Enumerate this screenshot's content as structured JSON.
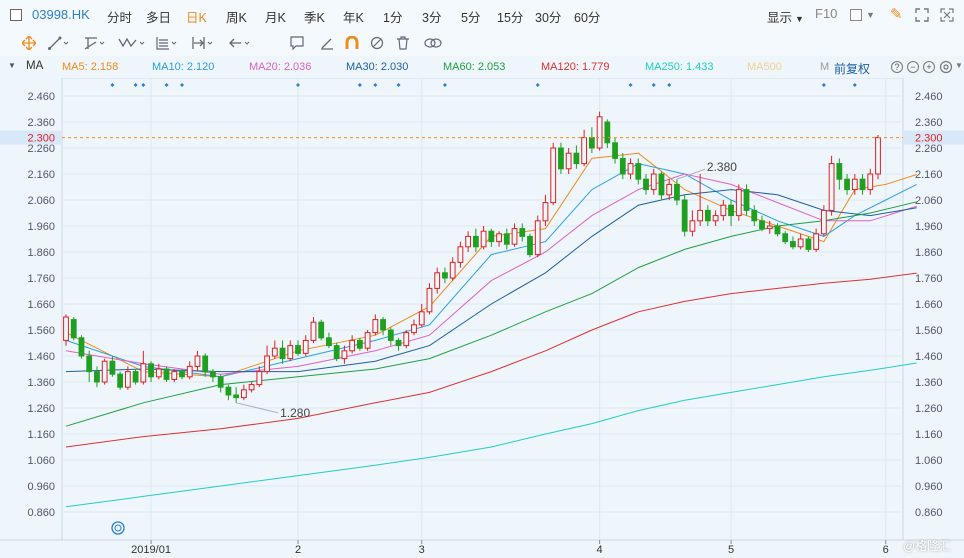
{
  "toolbar": {
    "ticker": "03998.HK",
    "periods": [
      "分时",
      "多日",
      "日K",
      "周K",
      "月K",
      "季K",
      "年K",
      "1分",
      "3分",
      "5分",
      "15分",
      "30分",
      "60分"
    ],
    "active_period": "日K",
    "display_label": "显示",
    "f10_label": "F10"
  },
  "drawing_tools": [
    "crosshair-icon",
    "line-icon",
    "channel-icon",
    "wave-icon",
    "fib-icon",
    "range-icon",
    "arrow-icon",
    "text-icon",
    "comment-icon",
    "pencil-icon",
    "magnet-icon",
    "hide-icon",
    "trash-icon",
    "link-icon"
  ],
  "drawing_text_label": "Aa",
  "indicator_bar": {
    "name": "MA",
    "items": [
      {
        "label": "MA5: 2.158",
        "color": "#f08c1a"
      },
      {
        "label": "MA10: 2.120",
        "color": "#2aa0e0"
      },
      {
        "label": "MA20: 2.036",
        "color": "#e060c0"
      },
      {
        "label": "MA30: 2.030",
        "color": "#2060a0"
      },
      {
        "label": "MA60: 2.053",
        "color": "#20a040"
      },
      {
        "label": "MA120: 1.779",
        "color": "#e03030"
      },
      {
        "label": "MA250: 1.433",
        "color": "#20d0c0"
      },
      {
        "label": "MA500",
        "color": "#f0d090"
      },
      {
        "label": "M",
        "color": "#999999"
      }
    ],
    "adjust_label": "前复权"
  },
  "chart_data": {
    "type": "candlestick",
    "y_ticks": [
      "2.460",
      "2.360",
      "2.260",
      "2.160",
      "2.060",
      "1.960",
      "1.860",
      "1.760",
      "1.660",
      "1.560",
      "1.460",
      "1.360",
      "1.260",
      "1.160",
      "1.060",
      "0.960",
      "0.860"
    ],
    "ylim": [
      0.82,
      2.5
    ],
    "x_labels": [
      "2019/01",
      "2",
      "3",
      "4",
      "5",
      "6"
    ],
    "x_label_index": [
      11,
      30,
      46,
      69,
      86,
      106
    ],
    "current_price": "2.300",
    "high_annotation": "2.380",
    "low_annotation": "1.280",
    "high_index": 79,
    "low_index": 22,
    "up_color": "#e02020",
    "down_color": "#20a020",
    "candles": [
      [
        1.52,
        1.61,
        1.62,
        1.5
      ],
      [
        1.6,
        1.53,
        1.61,
        1.52
      ],
      [
        1.53,
        1.46,
        1.54,
        1.45
      ],
      [
        1.46,
        1.4,
        1.48,
        1.36
      ],
      [
        1.4,
        1.36,
        1.42,
        1.34
      ],
      [
        1.36,
        1.44,
        1.45,
        1.35
      ],
      [
        1.44,
        1.39,
        1.46,
        1.38
      ],
      [
        1.39,
        1.34,
        1.4,
        1.33
      ],
      [
        1.34,
        1.4,
        1.42,
        1.33
      ],
      [
        1.4,
        1.36,
        1.41,
        1.35
      ],
      [
        1.36,
        1.43,
        1.48,
        1.35
      ],
      [
        1.43,
        1.38,
        1.44,
        1.36
      ],
      [
        1.38,
        1.41,
        1.43,
        1.37
      ],
      [
        1.41,
        1.37,
        1.42,
        1.36
      ],
      [
        1.37,
        1.4,
        1.41,
        1.36
      ],
      [
        1.4,
        1.38,
        1.41,
        1.37
      ],
      [
        1.38,
        1.42,
        1.44,
        1.37
      ],
      [
        1.42,
        1.46,
        1.48,
        1.4
      ],
      [
        1.46,
        1.4,
        1.47,
        1.38
      ],
      [
        1.4,
        1.38,
        1.41,
        1.36
      ],
      [
        1.38,
        1.34,
        1.39,
        1.32
      ],
      [
        1.34,
        1.31,
        1.35,
        1.29
      ],
      [
        1.31,
        1.3,
        1.34,
        1.28
      ],
      [
        1.3,
        1.33,
        1.35,
        1.29
      ],
      [
        1.33,
        1.35,
        1.36,
        1.32
      ],
      [
        1.35,
        1.4,
        1.42,
        1.34
      ],
      [
        1.4,
        1.46,
        1.5,
        1.39
      ],
      [
        1.46,
        1.49,
        1.52,
        1.45
      ],
      [
        1.49,
        1.45,
        1.52,
        1.43
      ],
      [
        1.45,
        1.5,
        1.52,
        1.44
      ],
      [
        1.5,
        1.47,
        1.52,
        1.46
      ],
      [
        1.47,
        1.52,
        1.54,
        1.46
      ],
      [
        1.52,
        1.59,
        1.61,
        1.51
      ],
      [
        1.59,
        1.53,
        1.6,
        1.52
      ],
      [
        1.53,
        1.5,
        1.55,
        1.49
      ],
      [
        1.5,
        1.45,
        1.51,
        1.44
      ],
      [
        1.45,
        1.48,
        1.5,
        1.43
      ],
      [
        1.48,
        1.52,
        1.54,
        1.47
      ],
      [
        1.52,
        1.49,
        1.53,
        1.48
      ],
      [
        1.49,
        1.55,
        1.56,
        1.48
      ],
      [
        1.55,
        1.6,
        1.62,
        1.54
      ],
      [
        1.6,
        1.56,
        1.61,
        1.54
      ],
      [
        1.56,
        1.52,
        1.57,
        1.5
      ],
      [
        1.52,
        1.5,
        1.53,
        1.48
      ],
      [
        1.5,
        1.55,
        1.56,
        1.49
      ],
      [
        1.55,
        1.58,
        1.6,
        1.54
      ],
      [
        1.58,
        1.63,
        1.66,
        1.57
      ],
      [
        1.63,
        1.72,
        1.74,
        1.62
      ],
      [
        1.72,
        1.78,
        1.8,
        1.7
      ],
      [
        1.78,
        1.76,
        1.8,
        1.74
      ],
      [
        1.76,
        1.82,
        1.84,
        1.75
      ],
      [
        1.82,
        1.88,
        1.9,
        1.8
      ],
      [
        1.88,
        1.92,
        1.94,
        1.86
      ],
      [
        1.92,
        1.88,
        1.95,
        1.86
      ],
      [
        1.88,
        1.94,
        1.96,
        1.87
      ],
      [
        1.94,
        1.9,
        1.95,
        1.88
      ],
      [
        1.9,
        1.93,
        1.94,
        1.88
      ],
      [
        1.93,
        1.89,
        1.95,
        1.87
      ],
      [
        1.89,
        1.95,
        1.97,
        1.88
      ],
      [
        1.95,
        1.92,
        1.97,
        1.9
      ],
      [
        1.92,
        1.85,
        1.93,
        1.84
      ],
      [
        1.85,
        1.98,
        2.0,
        1.84
      ],
      [
        1.98,
        2.05,
        2.08,
        1.96
      ],
      [
        2.05,
        2.26,
        2.28,
        2.04
      ],
      [
        2.26,
        2.18,
        2.28,
        2.16
      ],
      [
        2.18,
        2.24,
        2.26,
        2.16
      ],
      [
        2.24,
        2.2,
        2.27,
        2.18
      ],
      [
        2.2,
        2.3,
        2.33,
        2.19
      ],
      [
        2.3,
        2.26,
        2.34,
        2.24
      ],
      [
        2.26,
        2.38,
        2.4,
        2.25
      ],
      [
        2.36,
        2.28,
        2.37,
        2.26
      ],
      [
        2.28,
        2.22,
        2.3,
        2.2
      ],
      [
        2.22,
        2.16,
        2.24,
        2.14
      ],
      [
        2.16,
        2.2,
        2.22,
        2.14
      ],
      [
        2.2,
        2.14,
        2.22,
        2.12
      ],
      [
        2.14,
        2.1,
        2.16,
        2.08
      ],
      [
        2.1,
        2.16,
        2.18,
        2.08
      ],
      [
        2.16,
        2.08,
        2.17,
        2.06
      ],
      [
        2.08,
        2.12,
        2.14,
        2.06
      ],
      [
        2.12,
        2.06,
        2.14,
        2.04
      ],
      [
        2.06,
        1.94,
        2.08,
        1.92
      ],
      [
        1.94,
        1.98,
        2.02,
        1.92
      ],
      [
        1.98,
        2.02,
        2.16,
        1.96
      ],
      [
        2.02,
        1.98,
        2.04,
        1.96
      ],
      [
        1.98,
        2.0,
        2.02,
        1.96
      ],
      [
        2.0,
        2.04,
        2.06,
        1.98
      ],
      [
        2.04,
        2.0,
        2.06,
        1.96
      ],
      [
        2.0,
        2.1,
        2.12,
        1.98
      ],
      [
        2.1,
        2.02,
        2.12,
        2.0
      ],
      [
        2.02,
        1.98,
        2.04,
        1.96
      ],
      [
        1.98,
        1.95,
        2.0,
        1.94
      ],
      [
        1.95,
        1.96,
        1.98,
        1.93
      ],
      [
        1.96,
        1.93,
        1.97,
        1.92
      ],
      [
        1.93,
        1.9,
        1.94,
        1.89
      ],
      [
        1.9,
        1.88,
        1.92,
        1.87
      ],
      [
        1.88,
        1.91,
        1.93,
        1.87
      ],
      [
        1.91,
        1.87,
        1.92,
        1.86
      ],
      [
        1.87,
        1.93,
        1.95,
        1.86
      ],
      [
        1.93,
        2.02,
        2.04,
        1.92
      ],
      [
        2.02,
        2.2,
        2.23,
        2.0
      ],
      [
        2.2,
        2.14,
        2.22,
        2.1
      ],
      [
        2.14,
        2.1,
        2.16,
        2.08
      ],
      [
        2.1,
        2.14,
        2.16,
        2.08
      ],
      [
        2.14,
        2.1,
        2.16,
        2.08
      ],
      [
        2.1,
        2.16,
        2.18,
        2.08
      ],
      [
        2.16,
        2.3,
        2.31,
        2.14
      ]
    ],
    "ma_lines": [
      {
        "name": "MA5",
        "color": "#f08c1a",
        "points": [
          [
            0,
            1.55
          ],
          [
            10,
            1.4
          ],
          [
            20,
            1.38
          ],
          [
            30,
            1.48
          ],
          [
            40,
            1.54
          ],
          [
            47,
            1.65
          ],
          [
            55,
            1.92
          ],
          [
            62,
            1.95
          ],
          [
            68,
            2.22
          ],
          [
            74,
            2.24
          ],
          [
            80,
            2.1
          ],
          [
            86,
            2.02
          ],
          [
            92,
            1.96
          ],
          [
            98,
            1.9
          ],
          [
            102,
            2.1
          ],
          [
            106,
            2.12
          ],
          [
            110,
            2.158
          ]
        ]
      },
      {
        "name": "MA10",
        "color": "#2aa0e0",
        "points": [
          [
            0,
            1.52
          ],
          [
            10,
            1.42
          ],
          [
            20,
            1.38
          ],
          [
            30,
            1.45
          ],
          [
            40,
            1.52
          ],
          [
            47,
            1.58
          ],
          [
            55,
            1.85
          ],
          [
            62,
            1.9
          ],
          [
            68,
            2.1
          ],
          [
            74,
            2.2
          ],
          [
            80,
            2.16
          ],
          [
            86,
            2.06
          ],
          [
            92,
            1.98
          ],
          [
            98,
            1.92
          ],
          [
            102,
            2.0
          ],
          [
            106,
            2.06
          ],
          [
            110,
            2.12
          ]
        ]
      },
      {
        "name": "MA20",
        "color": "#e060c0",
        "points": [
          [
            0,
            1.48
          ],
          [
            10,
            1.43
          ],
          [
            20,
            1.39
          ],
          [
            30,
            1.42
          ],
          [
            40,
            1.48
          ],
          [
            47,
            1.54
          ],
          [
            55,
            1.75
          ],
          [
            62,
            1.86
          ],
          [
            68,
            2.0
          ],
          [
            74,
            2.1
          ],
          [
            80,
            2.16
          ],
          [
            86,
            2.12
          ],
          [
            92,
            2.05
          ],
          [
            98,
            1.98
          ],
          [
            104,
            1.98
          ],
          [
            110,
            2.036
          ]
        ]
      },
      {
        "name": "MA30",
        "color": "#2060a0",
        "points": [
          [
            0,
            1.4
          ],
          [
            10,
            1.41
          ],
          [
            20,
            1.4
          ],
          [
            30,
            1.4
          ],
          [
            40,
            1.44
          ],
          [
            47,
            1.5
          ],
          [
            55,
            1.66
          ],
          [
            62,
            1.78
          ],
          [
            68,
            1.92
          ],
          [
            74,
            2.04
          ],
          [
            80,
            2.08
          ],
          [
            86,
            2.1
          ],
          [
            92,
            2.08
          ],
          [
            98,
            2.02
          ],
          [
            104,
            2.0
          ],
          [
            110,
            2.03
          ]
        ]
      },
      {
        "name": "MA60",
        "color": "#20a040",
        "points": [
          [
            0,
            1.19
          ],
          [
            10,
            1.28
          ],
          [
            20,
            1.35
          ],
          [
            30,
            1.38
          ],
          [
            40,
            1.41
          ],
          [
            47,
            1.45
          ],
          [
            55,
            1.54
          ],
          [
            62,
            1.63
          ],
          [
            68,
            1.7
          ],
          [
            74,
            1.8
          ],
          [
            80,
            1.87
          ],
          [
            86,
            1.92
          ],
          [
            92,
            1.96
          ],
          [
            98,
            1.98
          ],
          [
            104,
            2.01
          ],
          [
            110,
            2.053
          ]
        ]
      },
      {
        "name": "MA120",
        "color": "#e03030",
        "points": [
          [
            0,
            1.11
          ],
          [
            10,
            1.15
          ],
          [
            20,
            1.18
          ],
          [
            30,
            1.22
          ],
          [
            40,
            1.28
          ],
          [
            47,
            1.32
          ],
          [
            55,
            1.4
          ],
          [
            62,
            1.48
          ],
          [
            68,
            1.56
          ],
          [
            74,
            1.63
          ],
          [
            80,
            1.67
          ],
          [
            86,
            1.7
          ],
          [
            92,
            1.72
          ],
          [
            98,
            1.74
          ],
          [
            104,
            1.755
          ],
          [
            110,
            1.779
          ]
        ]
      },
      {
        "name": "MA250",
        "color": "#20d0c0",
        "points": [
          [
            0,
            0.88
          ],
          [
            10,
            0.92
          ],
          [
            20,
            0.96
          ],
          [
            30,
            1.0
          ],
          [
            40,
            1.04
          ],
          [
            47,
            1.07
          ],
          [
            55,
            1.11
          ],
          [
            62,
            1.16
          ],
          [
            68,
            1.2
          ],
          [
            74,
            1.25
          ],
          [
            80,
            1.29
          ],
          [
            86,
            1.32
          ],
          [
            92,
            1.35
          ],
          [
            98,
            1.38
          ],
          [
            104,
            1.405
          ],
          [
            110,
            1.433
          ]
        ]
      }
    ],
    "marker_index": [
      6,
      9,
      10,
      13,
      15,
      30,
      38,
      40,
      43,
      49,
      61,
      73,
      76,
      78,
      98,
      102
    ]
  },
  "watermark": "@格隆汇"
}
